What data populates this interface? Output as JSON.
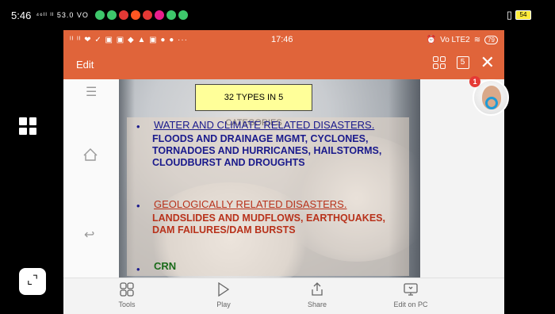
{
  "outer_status": {
    "time": "5:46",
    "signal": "⁴⁶ᴵᴵ ᴵᴵ 53.0 VO",
    "notif_colors": [
      "#3ec76b",
      "#3ec76b",
      "#e53935",
      "#ff5722",
      "#e53935",
      "#e91e8c",
      "#3ec76b",
      "#3ec76b"
    ],
    "battery": "54"
  },
  "inner_status": {
    "left": "ᴵᴵ ᴵᴵ ❤ ✓ ▣ ▣ ◆ ▲ ▣ ● ● ···",
    "time": "17:46",
    "right": "Vo LTE2",
    "battery": "79"
  },
  "toolbar": {
    "edit_label": "Edit",
    "pages_count": "5"
  },
  "slide": {
    "title": "32 TYPES IN 5 CATEGORIES",
    "bullets": [
      {
        "mark": "•",
        "heading": "WATER AND CLIMATE RELATED DISASTERS.",
        "body": "FLOODS AND DRAINAGE MGMT, CYCLONES, TORNADOES AND HURRICANES, HAILSTORMS, CLOUDBURST AND DROUGHTS"
      },
      {
        "mark": "•",
        "heading": "GEOLOGICALLY RELATED DISASTERS.",
        "body": "LANDSLIDES AND MUDFLOWS, EARTHQUAKES, DAM FAILURES/DAM BURSTS"
      },
      {
        "mark": "•",
        "heading": "CRN",
        "body": ""
      }
    ]
  },
  "bottom_bar": {
    "tools": "Tools",
    "play": "Play",
    "share": "Share",
    "edit_pc": "Edit on PC"
  },
  "avatar": {
    "badge": "1"
  }
}
